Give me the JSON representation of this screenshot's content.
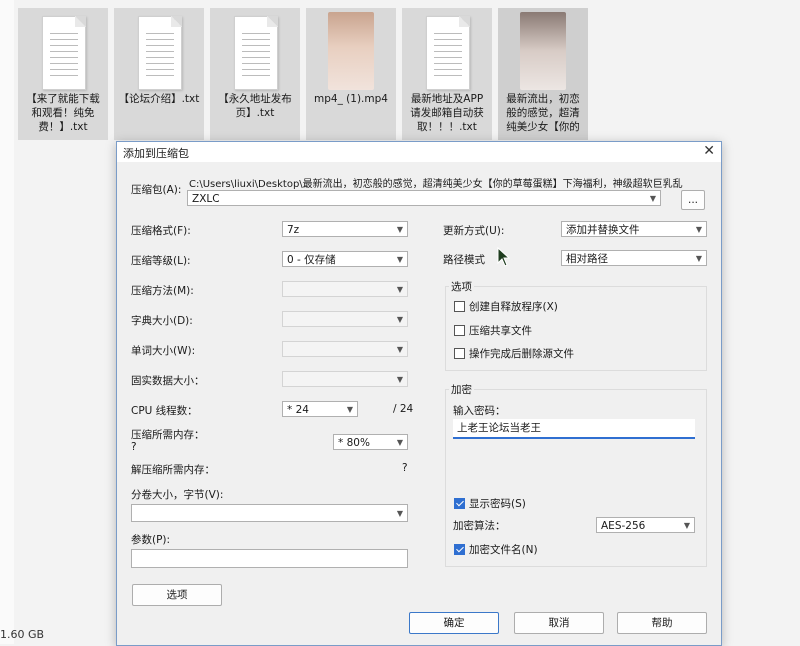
{
  "files": [
    {
      "name": "【来了就能下载和观看！纯免费！】.txt",
      "type": "txt"
    },
    {
      "name": "【论坛介绍】.txt",
      "type": "txt"
    },
    {
      "name": "【永久地址发布页】.txt",
      "type": "txt"
    },
    {
      "name": "mp4_ (1).mp4",
      "type": "video"
    },
    {
      "name": "最新地址及APP请发邮箱自动获取！！！.txt",
      "type": "txt"
    },
    {
      "name": "最新流出，初恋般的感觉，超清纯美少女【你的",
      "type": "video"
    }
  ],
  "status": {
    "size": "1.60 GB"
  },
  "dialog": {
    "title": "添加到压缩包",
    "archive_label": "压缩包(A):",
    "archive_path": "C:\\Users\\liuxi\\Desktop\\最新流出，初恋般的感觉，超清纯美少女【你的草莓蛋糕】下海福利，神级超软巨乳乱",
    "archive_name": "ZXLC",
    "browse": "...",
    "format_label": "压缩格式(F):",
    "format_value": "7z",
    "level_label": "压缩等级(L):",
    "level_value": "0 - 仅存储",
    "method_label": "压缩方法(M):",
    "dict_label": "字典大小(D):",
    "word_label": "单词大小(W):",
    "solid_label": "固实数据大小：",
    "cpu_label": "CPU 线程数：",
    "cpu_value": "* 24",
    "cpu_total": "/ 24",
    "mem_label": "压缩所需内存：",
    "mem_q": "?",
    "mem_value": "* 80%",
    "decomp_label": "解压缩所需内存：",
    "decomp_q": "?",
    "split_label": "分卷大小，字节(V):",
    "params_label": "参数(P):",
    "options_button": "选项",
    "update_label": "更新方式(U):",
    "update_value": "添加并替换文件",
    "path_label": "路径模式",
    "path_value": "相对路径",
    "options_group": "选项",
    "opt_sfx": "创建自释放程序(X)",
    "opt_shared": "压缩共享文件",
    "opt_delete": "操作完成后删除源文件",
    "enc_group": "加密",
    "pwd_label": "输入密码：",
    "pwd_value": "上老王论坛当老王",
    "show_pwd": "显示密码(S)",
    "enc_method_label": "加密算法：",
    "enc_method_value": "AES-256",
    "enc_names": "加密文件名(N)",
    "ok": "确定",
    "cancel": "取消",
    "help": "帮助"
  }
}
